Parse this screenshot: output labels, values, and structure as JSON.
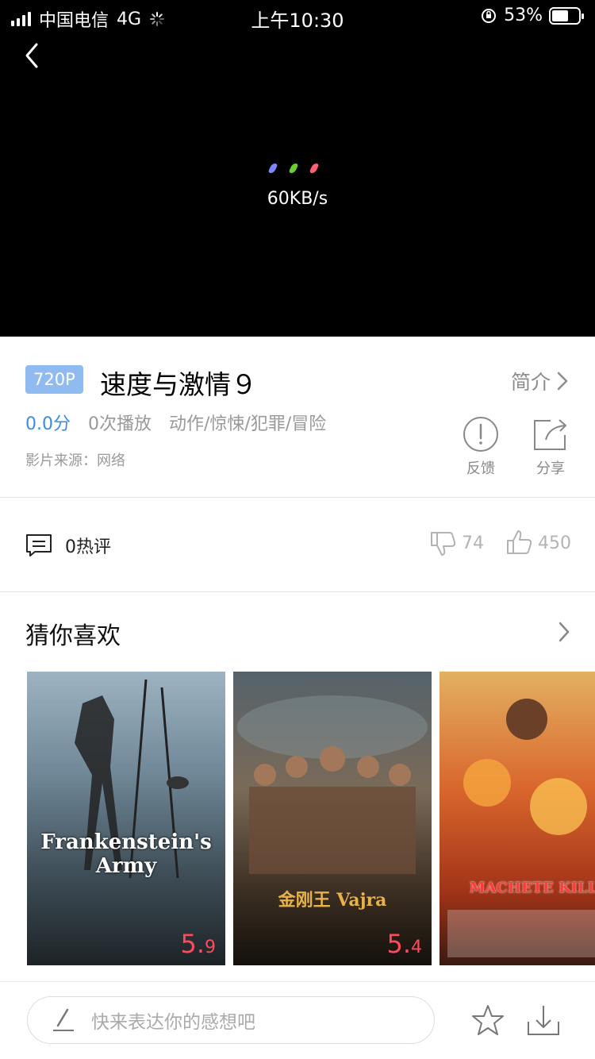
{
  "status_bar": {
    "carrier": "中国电信",
    "network": "4G",
    "time": "上午10:30",
    "battery": "53%"
  },
  "player": {
    "speed": "60KB/s",
    "loader_colors": [
      "#7b87ff",
      "#6ccf2c",
      "#ff5f73"
    ]
  },
  "movie": {
    "quality_badge": "720P",
    "title": "速度与激情９",
    "intro_label": "简介",
    "score": "0.0分",
    "plays": "0次播放",
    "genres": "动作/惊悚/犯罪/冒险",
    "source": "影片来源：网络",
    "feedback_label": "反馈",
    "share_label": "分享"
  },
  "comments": {
    "hot_label": "0热评",
    "dislikes": "74",
    "likes": "450"
  },
  "recommend": {
    "title": "猜你喜欢",
    "items": [
      {
        "title_text": "Frankenstein's Army",
        "rating_int": "5.",
        "rating_dec": "9"
      },
      {
        "title_text": "金刚王 Vajra",
        "rating_int": "5.",
        "rating_dec": "4"
      },
      {
        "title_text": "MACHETE KILLS",
        "rating_int": "",
        "rating_dec": ""
      }
    ]
  },
  "bottom_bar": {
    "comment_placeholder": "快来表达你的感想吧"
  },
  "colors": {
    "accent": "#3c8ce7",
    "badge": "#8fbbf0",
    "rating": "#ff4a5a"
  }
}
